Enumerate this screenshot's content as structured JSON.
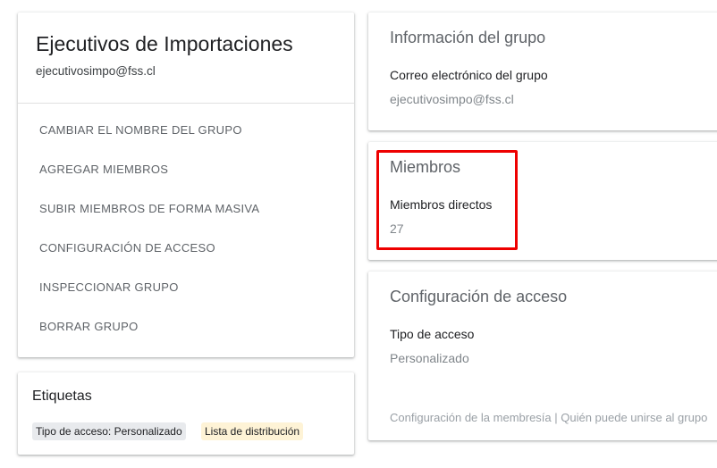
{
  "group": {
    "title": "Ejecutivos de Importaciones",
    "email": "ejecutivosimpo@fss.cl",
    "actions": [
      "CAMBIAR EL NOMBRE DEL GRUPO",
      "AGREGAR MIEMBROS",
      "SUBIR MIEMBROS DE FORMA MASIVA",
      "CONFIGURACIÓN DE ACCESO",
      "INSPECCIONAR GRUPO",
      "BORRAR GRUPO"
    ]
  },
  "labels": {
    "title": "Etiquetas",
    "chips": [
      "Tipo de acceso: Personalizado",
      "Lista de distribución"
    ]
  },
  "info": {
    "title": "Información del grupo",
    "email_label": "Correo electrónico del grupo",
    "email_value": "ejecutivosimpo@fss.cl"
  },
  "members": {
    "title": "Miembros",
    "direct_label": "Miembros directos",
    "direct_count": "27"
  },
  "access": {
    "title": "Configuración de acceso",
    "type_label": "Tipo de acceso",
    "type_value": "Personalizado",
    "footer": "Configuración de la membresía | Quién puede unirse al grupo"
  },
  "colors": {
    "highlight": "#ee0000",
    "chip_access_bg": "#e8eaed",
    "chip_list_bg": "#fef3d6"
  }
}
